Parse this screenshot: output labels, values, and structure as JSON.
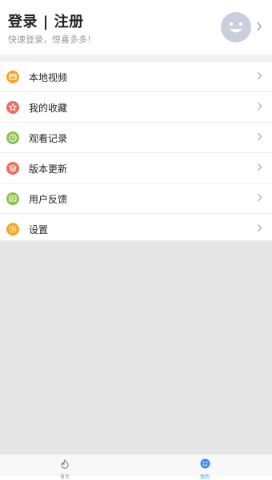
{
  "header": {
    "title": "登录 | 注册",
    "subtitle": "快速登录，惊喜多多！"
  },
  "menu": {
    "items": [
      {
        "label": "本地视频",
        "icon": "folder-icon",
        "color": "#f5a623"
      },
      {
        "label": "我的收藏",
        "icon": "star-icon",
        "color": "#ef6a5f"
      },
      {
        "label": "观看记录",
        "icon": "clock-icon",
        "color": "#8cc152"
      },
      {
        "label": "版本更新",
        "icon": "layers-icon",
        "color": "#ef6a5f"
      },
      {
        "label": "用户反馈",
        "icon": "message-icon",
        "color": "#8cc152"
      },
      {
        "label": "设置",
        "icon": "gear-icon",
        "color": "#f5a623"
      }
    ]
  },
  "tabs": [
    {
      "label": "首页",
      "icon": "flame-icon",
      "active": false
    },
    {
      "label": "我的",
      "icon": "smile-icon",
      "active": true
    }
  ],
  "colors": {
    "accent": "#3d8ef0",
    "avatar_bg": "#c9cfdc",
    "content_bg": "#e6e6e6"
  }
}
